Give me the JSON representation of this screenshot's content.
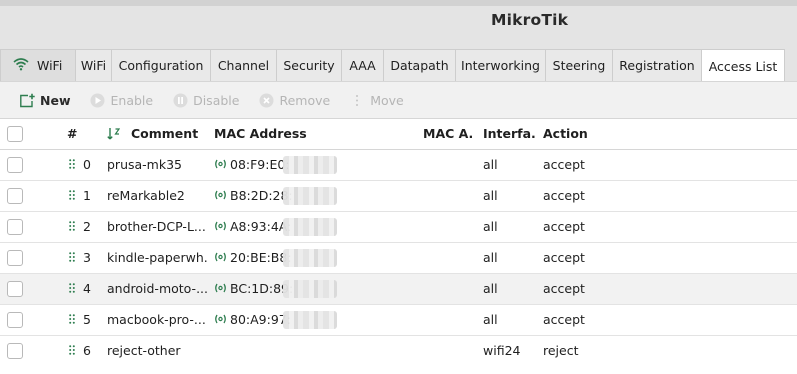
{
  "app": {
    "title": "MikroTik"
  },
  "tabs": [
    {
      "label": "WiFi",
      "icon": "wifi-icon"
    },
    {
      "label": "WiFi"
    },
    {
      "label": "Configuration"
    },
    {
      "label": "Channel"
    },
    {
      "label": "Security"
    },
    {
      "label": "AAA"
    },
    {
      "label": "Datapath"
    },
    {
      "label": "Interworking"
    },
    {
      "label": "Steering"
    },
    {
      "label": "Registration"
    },
    {
      "label": "Access List",
      "active": true
    }
  ],
  "toolbar": {
    "new_label": "New",
    "enable_label": "Enable",
    "disable_label": "Disable",
    "remove_label": "Remove",
    "move_label": "Move"
  },
  "columns": {
    "index": "#",
    "comment": "Comment",
    "mac_address": "MAC Address",
    "mac_mask": "MAC A...",
    "interface": "Interfa...",
    "action": "Action"
  },
  "rows": [
    {
      "index": "0",
      "comment": "prusa-mk35",
      "mac": "08:F9:E0:",
      "interface": "all",
      "action": "accept"
    },
    {
      "index": "1",
      "comment": "reMarkable2",
      "mac": "B8:2D:28:",
      "interface": "all",
      "action": "accept"
    },
    {
      "index": "2",
      "comment": "brother-DCP-L...",
      "mac": "A8:93:4A:",
      "interface": "all",
      "action": "accept"
    },
    {
      "index": "3",
      "comment": "kindle-paperwh...",
      "mac": "20:BE:B8:",
      "interface": "all",
      "action": "accept"
    },
    {
      "index": "4",
      "comment": "android-moto-...",
      "mac": "BC:1D:89:",
      "interface": "all",
      "action": "accept"
    },
    {
      "index": "5",
      "comment": "macbook-pro-...",
      "mac": "80:A9:97:",
      "interface": "all",
      "action": "accept"
    },
    {
      "index": "6",
      "comment": "reject-other",
      "mac": "",
      "interface": "wifi24",
      "action": "reject"
    }
  ],
  "colors": {
    "accent_green": "#2e7d4f",
    "disabled_gray": "#b5b5b5",
    "hover_row": "#f2f2f2"
  }
}
